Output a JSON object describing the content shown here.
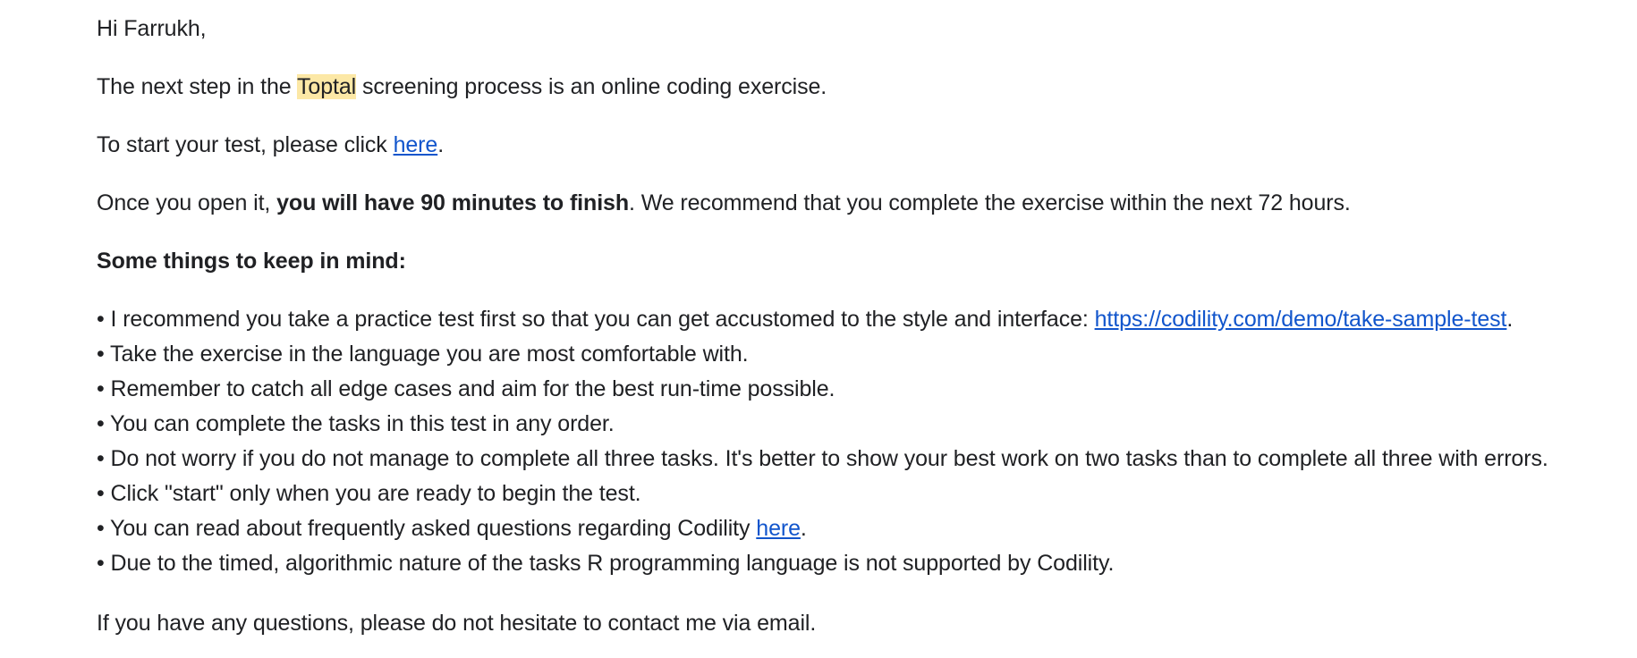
{
  "email": {
    "greeting": "Hi Farrukh,",
    "intro": {
      "before": "The next step in the ",
      "highlight": "Toptal",
      "after": " screening process is an online coding exercise."
    },
    "start": {
      "before": "To start your test, please click ",
      "link": "here",
      "after": "."
    },
    "duration": {
      "before": "Once you open it, ",
      "bold": "you will have 90 minutes to finish",
      "after": ". We recommend that you complete the exercise within the next 72 hours."
    },
    "tips_heading": "Some things to keep in mind:",
    "tips": [
      {
        "text": "• I recommend you take a practice test first so that you can get accustomed to the style and interface: ",
        "link": "https://codility.com/demo/take-sample-test",
        "after": "."
      },
      {
        "text": "• Take the exercise in the language you are most comfortable with."
      },
      {
        "text": "• Remember to catch all edge cases and aim for the best run-time possible."
      },
      {
        "text": "• You can complete the tasks in this test in any order."
      },
      {
        "text": "• Do not worry if you do not manage to complete all three tasks. It's better to show your best work on two tasks than to complete all three with errors."
      },
      {
        "text": "• Click \"start\" only when you are ready to begin the test."
      },
      {
        "text": "• You can read about frequently asked questions regarding Codility ",
        "link": "here",
        "after": "."
      },
      {
        "text": "• Due to the timed, algorithmic nature of the tasks R programming language is not supported by Codility."
      }
    ],
    "closing": "If you have any questions, please do not hesitate to contact me via email."
  },
  "colors": {
    "text": "#202124",
    "link": "#1155cc",
    "highlight": "#fce8a6"
  }
}
